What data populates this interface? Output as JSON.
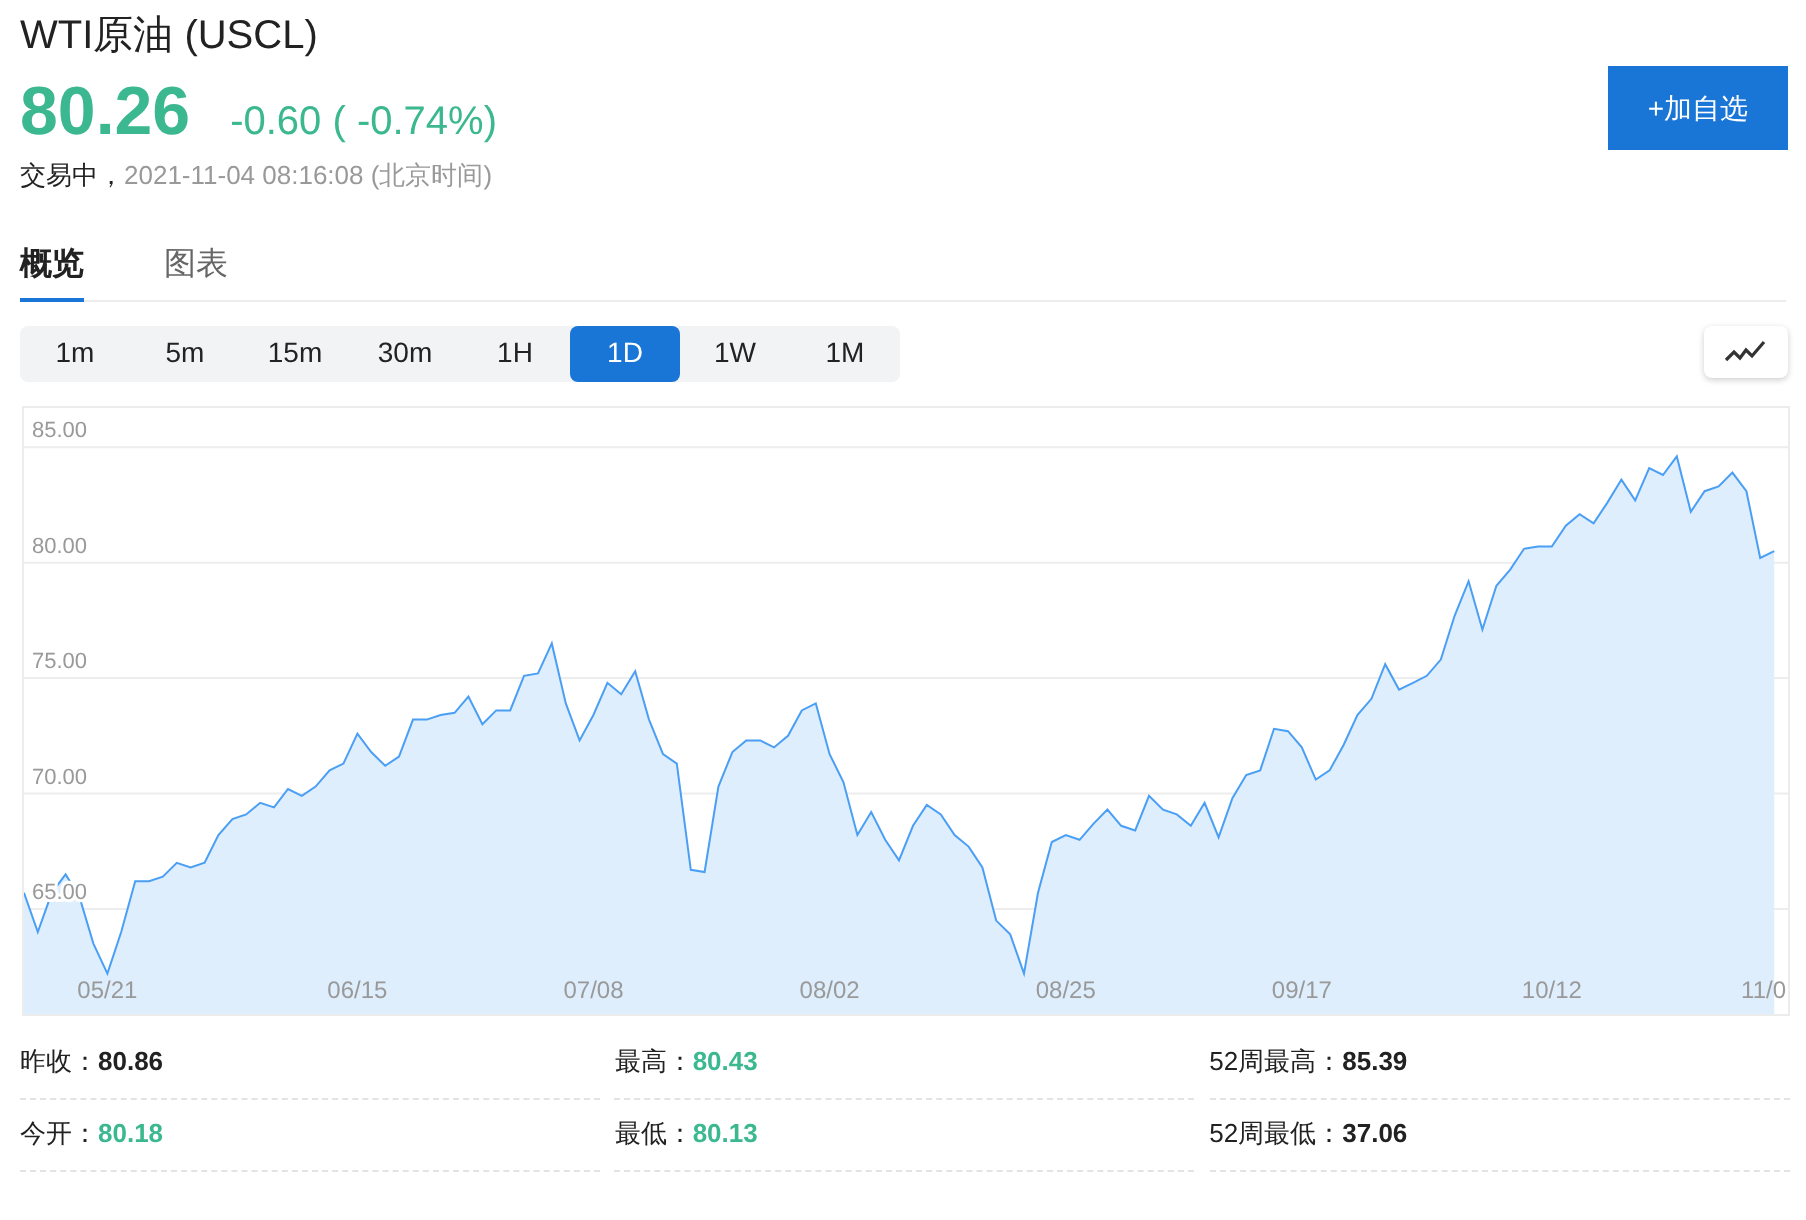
{
  "header": {
    "title": "WTI原油 (USCL)",
    "price": "80.26",
    "change": "-0.60 ( -0.74%)",
    "status": "交易中，",
    "timestamp": "2021-11-04 08:16:08 (北京时间)",
    "watchlist_button": "+加自选"
  },
  "tabs": [
    {
      "label": "概览",
      "selected": true
    },
    {
      "label": "图表",
      "selected": false
    }
  ],
  "periods": [
    {
      "label": "1m",
      "selected": false
    },
    {
      "label": "5m",
      "selected": false
    },
    {
      "label": "15m",
      "selected": false
    },
    {
      "label": "30m",
      "selected": false
    },
    {
      "label": "1H",
      "selected": false
    },
    {
      "label": "1D",
      "selected": true
    },
    {
      "label": "1W",
      "selected": false
    },
    {
      "label": "1M",
      "selected": false
    }
  ],
  "chart": {
    "chart_data": {
      "type": "area",
      "grid": true,
      "categories": [
        null,
        null,
        null,
        null,
        null,
        null,
        "05/21",
        null,
        null,
        null,
        null,
        null,
        null,
        null,
        null,
        null,
        null,
        null,
        null,
        null,
        null,
        null,
        null,
        null,
        "06/15",
        null,
        null,
        null,
        null,
        null,
        null,
        null,
        null,
        null,
        null,
        null,
        null,
        null,
        null,
        null,
        null,
        "07/08",
        null,
        null,
        null,
        null,
        null,
        null,
        null,
        null,
        null,
        null,
        null,
        null,
        null,
        null,
        null,
        null,
        "08/02",
        null,
        null,
        null,
        null,
        null,
        null,
        null,
        null,
        null,
        null,
        null,
        null,
        null,
        null,
        null,
        null,
        "08/25",
        null,
        null,
        null,
        null,
        null,
        null,
        null,
        null,
        null,
        null,
        null,
        null,
        null,
        null,
        null,
        null,
        "09/17",
        null,
        null,
        null,
        null,
        null,
        null,
        null,
        null,
        null,
        null,
        null,
        null,
        null,
        null,
        null,
        null,
        null,
        "10/12",
        null,
        null,
        null,
        null,
        null,
        null,
        null,
        null,
        null,
        null,
        null,
        null,
        null,
        null,
        null,
        "11/0"
      ],
      "ylim": [
        60.45,
        86.7
      ],
      "yticks": [
        {
          "value": 65,
          "label": "65.00"
        },
        {
          "value": 70,
          "label": "70.00"
        },
        {
          "value": 75,
          "label": "75.00"
        },
        {
          "value": 80,
          "label": "80.00"
        },
        {
          "value": 85,
          "label": "85.00"
        }
      ],
      "series": [
        {
          "color": "#4a9ff5",
          "values": [
            65.7,
            64.0,
            65.7,
            66.5,
            65.5,
            63.5,
            62.2,
            64.0,
            66.2,
            66.2,
            66.4,
            67.0,
            66.8,
            67.0,
            68.2,
            68.9,
            69.1,
            69.6,
            69.4,
            70.2,
            69.9,
            70.3,
            71.0,
            71.3,
            72.6,
            71.8,
            71.2,
            71.6,
            73.2,
            73.2,
            73.4,
            73.5,
            74.2,
            73.0,
            73.6,
            73.6,
            75.1,
            75.2,
            76.5,
            73.9,
            72.3,
            73.4,
            74.8,
            74.3,
            75.3,
            73.2,
            71.7,
            71.3,
            66.7,
            66.6,
            70.3,
            71.8,
            72.3,
            72.3,
            72.0,
            72.5,
            73.6,
            73.9,
            71.7,
            70.5,
            68.2,
            69.2,
            68.0,
            67.1,
            68.6,
            69.5,
            69.1,
            68.2,
            67.7,
            66.8,
            64.5,
            63.9,
            62.2,
            65.7,
            67.9,
            68.2,
            68.0,
            68.7,
            69.3,
            68.6,
            68.4,
            69.9,
            69.3,
            69.1,
            68.6,
            69.6,
            68.1,
            69.8,
            70.8,
            71.0,
            72.8,
            72.7,
            72.0,
            70.6,
            71.0,
            72.1,
            73.4,
            74.1,
            75.6,
            74.5,
            74.8,
            75.1,
            75.8,
            77.7,
            79.2,
            77.1,
            79.0,
            79.7,
            80.6,
            80.7,
            80.7,
            81.6,
            82.1,
            81.7,
            82.6,
            83.6,
            82.7,
            84.1,
            83.8,
            84.6,
            82.2,
            83.1,
            83.3,
            83.9,
            83.1,
            80.2,
            80.5
          ]
        }
      ]
    }
  },
  "stats": [
    {
      "label": "昨收：",
      "value": "80.86",
      "color": "#222222"
    },
    {
      "label": "最高：",
      "value": "80.43",
      "color": "#3cb890"
    },
    {
      "label": "52周最高：",
      "value": "85.39",
      "color": "#222222"
    },
    {
      "label": "今开：",
      "value": "80.18",
      "color": "#3cb890"
    },
    {
      "label": "最低：",
      "value": "80.13",
      "color": "#3cb890"
    },
    {
      "label": "52周最低：",
      "value": "37.06",
      "color": "#222222"
    }
  ]
}
